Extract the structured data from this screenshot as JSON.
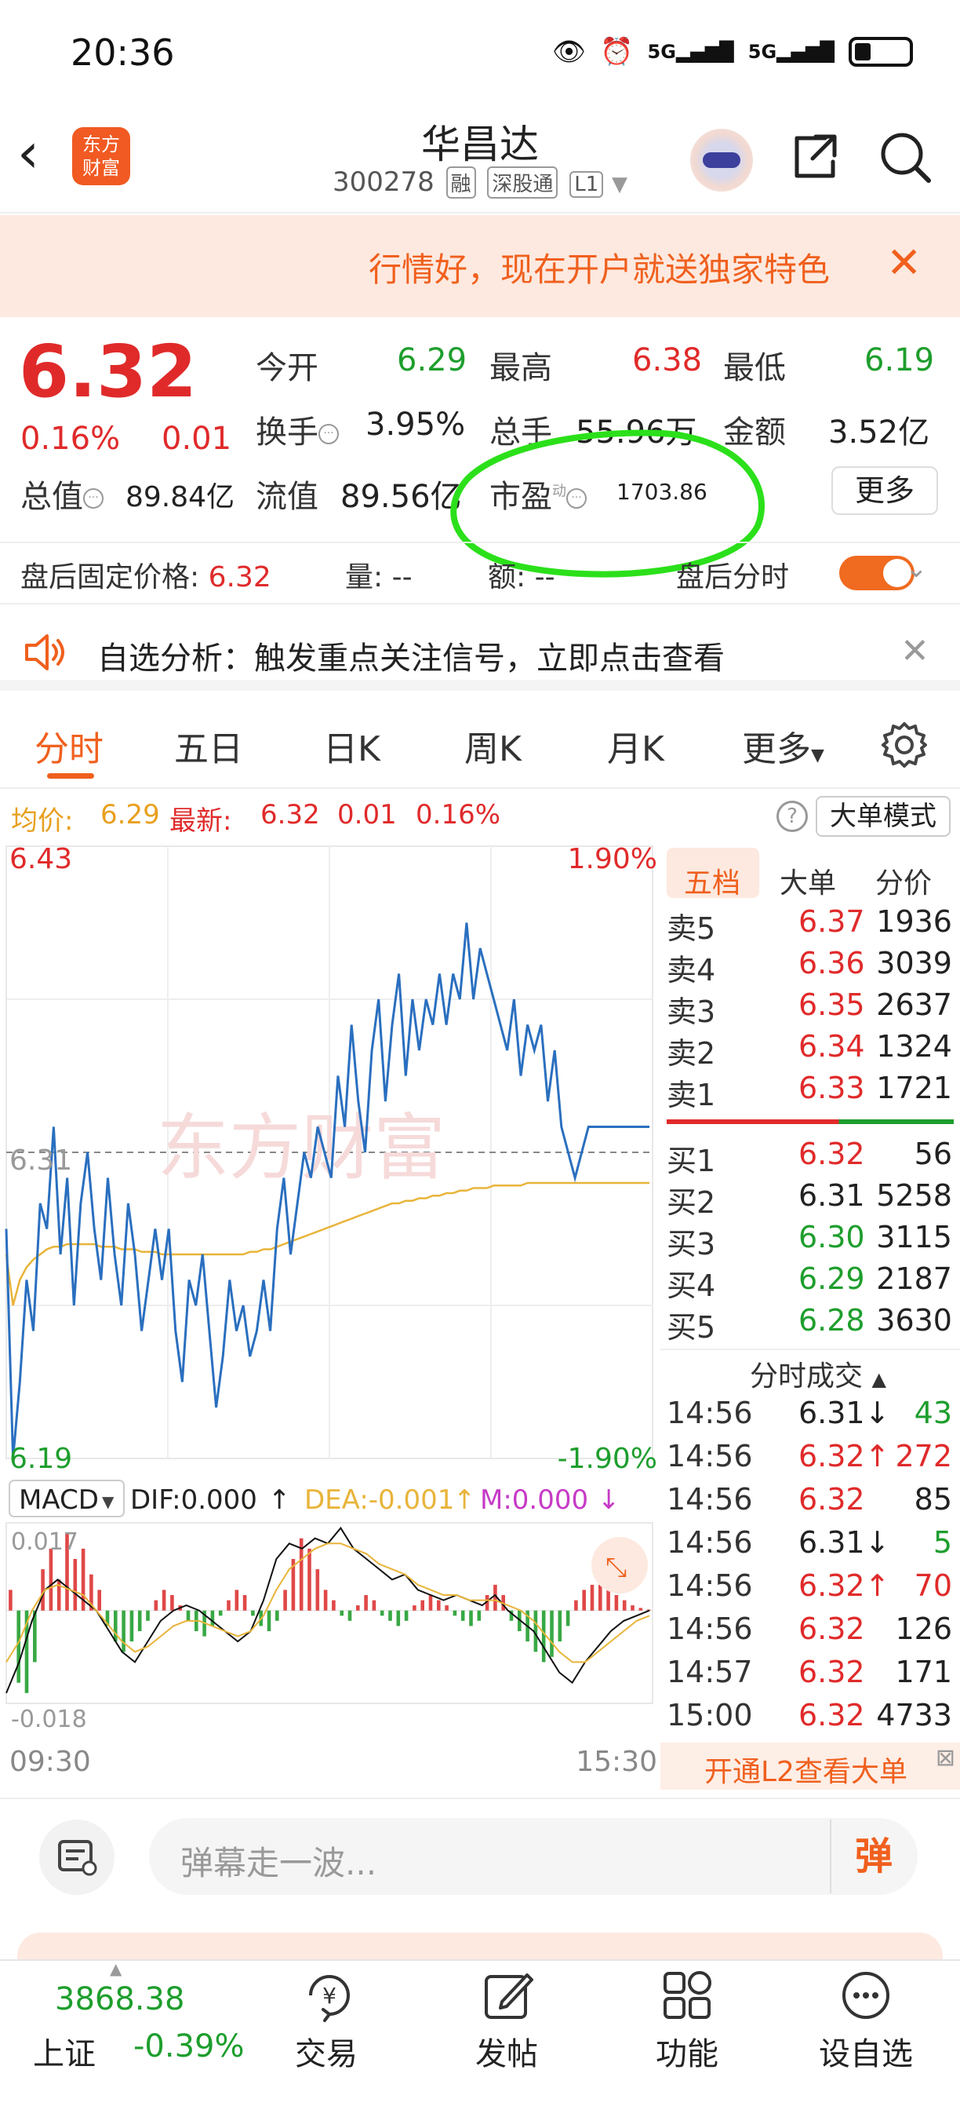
{
  "status": {
    "time": "20:36",
    "net1": "5G",
    "net2": "5G"
  },
  "header": {
    "logo_text_1": "东方",
    "logo_text_2": "财富",
    "stock_name": "华昌达",
    "stock_code": "300278",
    "tags": [
      "融",
      "深股通",
      "L1"
    ]
  },
  "banner": {
    "text": "行情好，现在开户就送独家特色"
  },
  "quote": {
    "price": "6.32",
    "change_pct": "0.16%",
    "change": "0.01",
    "open_label": "今开",
    "open": "6.29",
    "high_label": "最高",
    "high": "6.38",
    "low_label": "最低",
    "low": "6.19",
    "turnover_label": "换手",
    "turnover": "3.95%",
    "volume_label": "总手",
    "volume": "55.96万",
    "amount_label": "金额",
    "amount": "3.52亿",
    "mktcap_label": "总值",
    "mktcap": "89.84亿",
    "float_label": "流值",
    "float_cap": "89.56亿",
    "pe_label": "市盈",
    "pe_sup": "动",
    "pe": "1703.86",
    "more_label": "更多"
  },
  "after_hours": {
    "fixed_price_label": "盘后固定价格:",
    "fixed_price": "6.32",
    "volume_label": "量:",
    "volume": "--",
    "amount_label": "额:",
    "amount": "--",
    "intraday_label": "盘后分时"
  },
  "analysis": {
    "text": "自选分析：触发重点关注信号，立即点击查看"
  },
  "tabs": [
    "分时",
    "五日",
    "日K",
    "周K",
    "月K",
    "更多"
  ],
  "avg_row": {
    "avg_label": "均价:",
    "avg": "6.29",
    "latest_label": "最新:",
    "latest": "6.32",
    "change": "0.01",
    "pct": "0.16%",
    "big_order_mode": "大单模式"
  },
  "chart_data": {
    "type": "line",
    "y_top": "6.43",
    "y_mid": "6.31",
    "y_bottom": "6.19",
    "pct_top": "1.90%",
    "pct_bottom": "-1.90%",
    "ylim": [
      6.19,
      6.43
    ],
    "prev_close": 6.31,
    "x_start": "09:30",
    "x_end": "15:30",
    "watermark": "东方财富",
    "series": [
      {
        "values": [
          6.28,
          6.19,
          6.22,
          6.26,
          6.24,
          6.29,
          6.28,
          6.32,
          6.27,
          6.3,
          6.25,
          6.29,
          6.31,
          6.28,
          6.26,
          6.3,
          6.27,
          6.25,
          6.29,
          6.27,
          6.24,
          6.26,
          6.28,
          6.26,
          6.28,
          6.24,
          6.22,
          6.26,
          6.25,
          6.27,
          6.24,
          6.21,
          6.23,
          6.26,
          6.24,
          6.25,
          6.23,
          6.24,
          6.26,
          6.24,
          6.28,
          6.3,
          6.27,
          6.29,
          6.31,
          6.3,
          6.32,
          6.31,
          6.3,
          6.34,
          6.32,
          6.36,
          6.33,
          6.31,
          6.35,
          6.37,
          6.33,
          6.36,
          6.38,
          6.34,
          6.37,
          6.35,
          6.37,
          6.36,
          6.38,
          6.36,
          6.38,
          6.37,
          6.4,
          6.37,
          6.39,
          6.38,
          6.37,
          6.36,
          6.35,
          6.37,
          6.34,
          6.36,
          6.35,
          6.36,
          6.33,
          6.35,
          6.32,
          6.31,
          6.3,
          6.31,
          6.32,
          6.32,
          6.32,
          6.32,
          6.32,
          6.32,
          6.32,
          6.32,
          6.32,
          6.32
        ]
      },
      {
        "values": [
          6.27,
          6.25,
          6.26,
          6.265,
          6.268,
          6.27,
          6.272,
          6.273,
          6.273,
          6.274,
          6.274,
          6.274,
          6.274,
          6.274,
          6.273,
          6.273,
          6.273,
          6.272,
          6.272,
          6.272,
          6.271,
          6.271,
          6.271,
          6.27,
          6.27,
          6.27,
          6.27,
          6.27,
          6.27,
          6.27,
          6.27,
          6.27,
          6.27,
          6.27,
          6.27,
          6.27,
          6.271,
          6.271,
          6.272,
          6.272,
          6.273,
          6.274,
          6.275,
          6.276,
          6.277,
          6.278,
          6.279,
          6.28,
          6.281,
          6.282,
          6.283,
          6.284,
          6.285,
          6.286,
          6.287,
          6.288,
          6.289,
          6.29,
          6.29,
          6.291,
          6.291,
          6.292,
          6.292,
          6.293,
          6.293,
          6.294,
          6.294,
          6.295,
          6.295,
          6.296,
          6.296,
          6.296,
          6.297,
          6.297,
          6.297,
          6.297,
          6.297,
          6.298,
          6.298,
          6.298,
          6.298,
          6.298,
          6.298,
          6.298,
          6.298,
          6.298,
          6.298,
          6.298,
          6.298,
          6.298,
          6.298,
          6.298,
          6.298,
          6.298,
          6.298,
          6.298
        ]
      }
    ]
  },
  "macd": {
    "label": "MACD",
    "dif": "DIF:0.000",
    "dea": "DEA:-0.001",
    "m": "M:0.000",
    "ymax": "0.017",
    "ymin": "-0.018",
    "bars": [
      0.004,
      -0.014,
      -0.016,
      -0.01,
      0.008,
      0.012,
      0.006,
      0.015,
      0.01,
      0.012,
      0.007,
      0.004,
      -0.003,
      -0.006,
      -0.008,
      -0.006,
      -0.004,
      -0.002,
      0.002,
      0.004,
      0.003,
      0.001,
      -0.002,
      -0.004,
      -0.005,
      -0.003,
      -0.001,
      0.002,
      0.004,
      0.003,
      -0.001,
      -0.003,
      -0.004,
      -0.002,
      0.004,
      0.01,
      0.014,
      0.012,
      0.008,
      0.004,
      0.002,
      -0.001,
      -0.002,
      0.001,
      0.003,
      0.002,
      -0.001,
      -0.002,
      -0.003,
      -0.002,
      0.001,
      0.002,
      0.003,
      0.002,
      0.001,
      -0.001,
      -0.002,
      -0.003,
      -0.002,
      0.003,
      0.005,
      0.003,
      -0.002,
      -0.004,
      -0.006,
      -0.008,
      -0.01,
      -0.009,
      -0.006,
      -0.003,
      0.002,
      0.004,
      0.005,
      0.005,
      0.004,
      0.003,
      0.002,
      0.001,
      0.0005,
      0.0002
    ],
    "dif_line": [
      -0.016,
      -0.01,
      -0.002,
      0.004,
      0.006,
      0.004,
      0.002,
      0.0,
      -0.004,
      -0.008,
      -0.01,
      -0.006,
      -0.002,
      0.0,
      0.001,
      0.0,
      -0.002,
      -0.004,
      -0.006,
      -0.004,
      0.002,
      0.01,
      0.013,
      0.012,
      0.014,
      0.013,
      0.016,
      0.012,
      0.01,
      0.008,
      0.006,
      0.007,
      0.004,
      0.003,
      0.002,
      0.003,
      0.002,
      0.001,
      0.003,
      0.0,
      -0.002,
      -0.004,
      -0.008,
      -0.012,
      -0.014,
      -0.01,
      -0.007,
      -0.004,
      -0.002,
      -0.001,
      0.0
    ],
    "dea_line": [
      -0.01,
      -0.006,
      0.0,
      0.004,
      0.005,
      0.004,
      0.003,
      0.0,
      -0.003,
      -0.006,
      -0.008,
      -0.007,
      -0.005,
      -0.003,
      -0.002,
      -0.002,
      -0.003,
      -0.004,
      -0.005,
      -0.004,
      -0.001,
      0.004,
      0.008,
      0.01,
      0.012,
      0.013,
      0.013,
      0.012,
      0.011,
      0.009,
      0.008,
      0.007,
      0.005,
      0.004,
      0.003,
      0.003,
      0.002,
      0.002,
      0.002,
      0.001,
      0.0,
      -0.002,
      -0.005,
      -0.008,
      -0.01,
      -0.01,
      -0.008,
      -0.006,
      -0.004,
      -0.002,
      -0.001
    ]
  },
  "order_book": {
    "tabs": [
      "五档",
      "大单",
      "分价"
    ],
    "asks": [
      {
        "label": "卖5",
        "price": "6.37",
        "vol": "1936"
      },
      {
        "label": "卖4",
        "price": "6.36",
        "vol": "3039"
      },
      {
        "label": "卖3",
        "price": "6.35",
        "vol": "2637"
      },
      {
        "label": "卖2",
        "price": "6.34",
        "vol": "1324"
      },
      {
        "label": "卖1",
        "price": "6.33",
        "vol": "1721"
      }
    ],
    "bids": [
      {
        "label": "买1",
        "price": "6.32",
        "vol": "56"
      },
      {
        "label": "买2",
        "price": "6.31",
        "vol": "5258"
      },
      {
        "label": "买3",
        "price": "6.30",
        "vol": "3115"
      },
      {
        "label": "买4",
        "price": "6.29",
        "vol": "2187"
      },
      {
        "label": "买5",
        "price": "6.28",
        "vol": "3630"
      }
    ],
    "ticks_title": "分时成交",
    "ticks": [
      {
        "time": "14:56",
        "price": "6.31",
        "dir": "down",
        "vol": "43"
      },
      {
        "time": "14:56",
        "price": "6.32",
        "dir": "up",
        "vol": "272"
      },
      {
        "time": "14:56",
        "price": "6.32",
        "dir": "none",
        "vol": "85"
      },
      {
        "time": "14:56",
        "price": "6.31",
        "dir": "down",
        "vol": "5"
      },
      {
        "time": "14:56",
        "price": "6.32",
        "dir": "up",
        "vol": "70"
      },
      {
        "time": "14:56",
        "price": "6.32",
        "dir": "none",
        "vol": "126"
      },
      {
        "time": "14:57",
        "price": "6.32",
        "dir": "none",
        "vol": "171"
      },
      {
        "time": "15:00",
        "price": "6.32",
        "dir": "none",
        "vol": "4733"
      }
    ],
    "l2_text": "开通L2查看大单"
  },
  "danmu": {
    "placeholder": "弹幕走一波...",
    "send": "弹"
  },
  "bottom_nav": {
    "index_value": "3868.38",
    "index_name": "上证",
    "index_pct": "-0.39%",
    "items": [
      "交易",
      "发帖",
      "功能",
      "设自选"
    ]
  },
  "colors": {
    "up": "#e02a2a",
    "down": "#1e9e2d",
    "accent": "#f0601e",
    "price_line": "#2a6fbf",
    "avg_line": "#e8b43a"
  }
}
